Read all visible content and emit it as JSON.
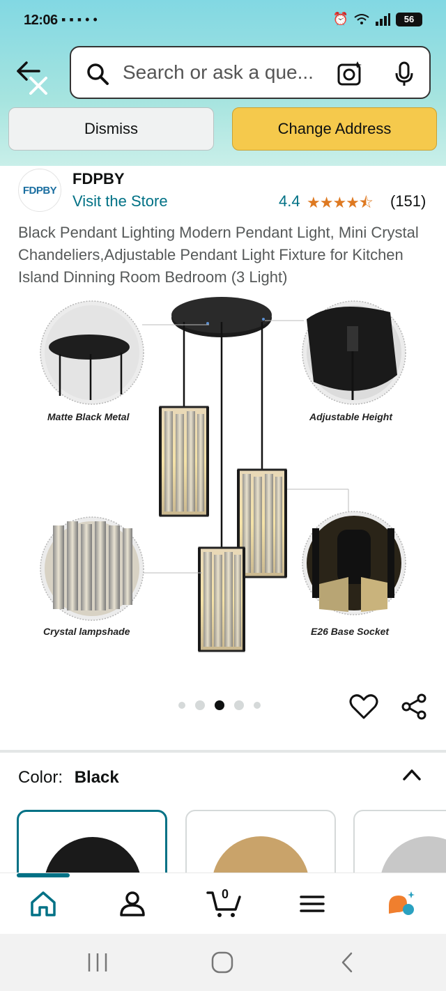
{
  "status_bar": {
    "time": "12:06",
    "battery": "56"
  },
  "search": {
    "placeholder": "Search or ask a que..."
  },
  "address_banner": {
    "dismiss_label": "Dismiss",
    "change_label": "Change Address"
  },
  "brand": {
    "logo_text": "FDPBY",
    "name": "FDPBY",
    "visit_store": "Visit the Store",
    "rating": "4.4",
    "stars": "★★★★⯪",
    "review_count": "(151)"
  },
  "product": {
    "title": "Black Pendant Lighting Modern Pendant Light, Mini Crystal Chandeliers,Adjustable Pendant Light Fixture for Kitchen Island Dinning Room Bedroom (3 Light)",
    "captions": {
      "top_left": "Matte Black Metal",
      "top_right": "Adjustable Height",
      "bottom_left": "Crystal lampshade",
      "bottom_right": "E26 Base Socket"
    },
    "image_count": 5,
    "active_image_index": 3
  },
  "variation": {
    "label": "Color:",
    "value": "Black",
    "swatch_colors": [
      "#1a1a1a",
      "#c9a36a",
      "#c8c8c8"
    ]
  },
  "bottom_nav": {
    "cart_count": "0",
    "items": [
      "home-icon",
      "account-icon",
      "cart-icon",
      "menu-icon",
      "rufus-icon"
    ]
  },
  "colors": {
    "accent": "#007185",
    "star": "#de7921",
    "change_button": "#f5c94c"
  }
}
